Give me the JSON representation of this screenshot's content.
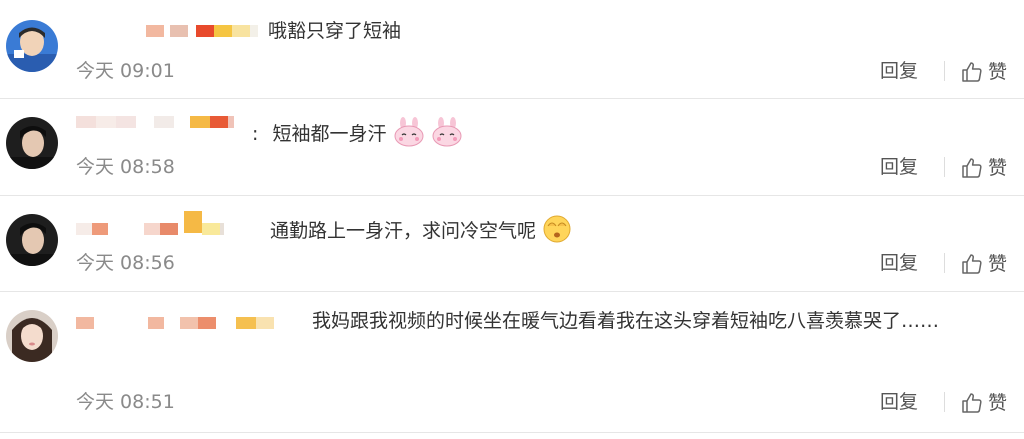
{
  "actions": {
    "reply_label": "回复",
    "like_label": "赞"
  },
  "comments": [
    {
      "text": "哦豁只穿了短袖",
      "time": "今天 09:01"
    },
    {
      "text": "短袖都一身汗",
      "time": "今天 08:58",
      "emojis": [
        "bunny-emoji",
        "bunny-emoji"
      ]
    },
    {
      "text": "通勤路上一身汗，求问冷空气呢",
      "time": "今天 08:56",
      "emojis": [
        "cover-face-emoji"
      ]
    },
    {
      "text": "我妈跟我视频的时候坐在暖气边看着我在这头穿着短袖吃八喜羡慕哭了……",
      "time": "今天 08:51"
    }
  ],
  "colors": {
    "text": "#333333",
    "time": "#8a8a8a",
    "divider": "#e6e6e6"
  }
}
